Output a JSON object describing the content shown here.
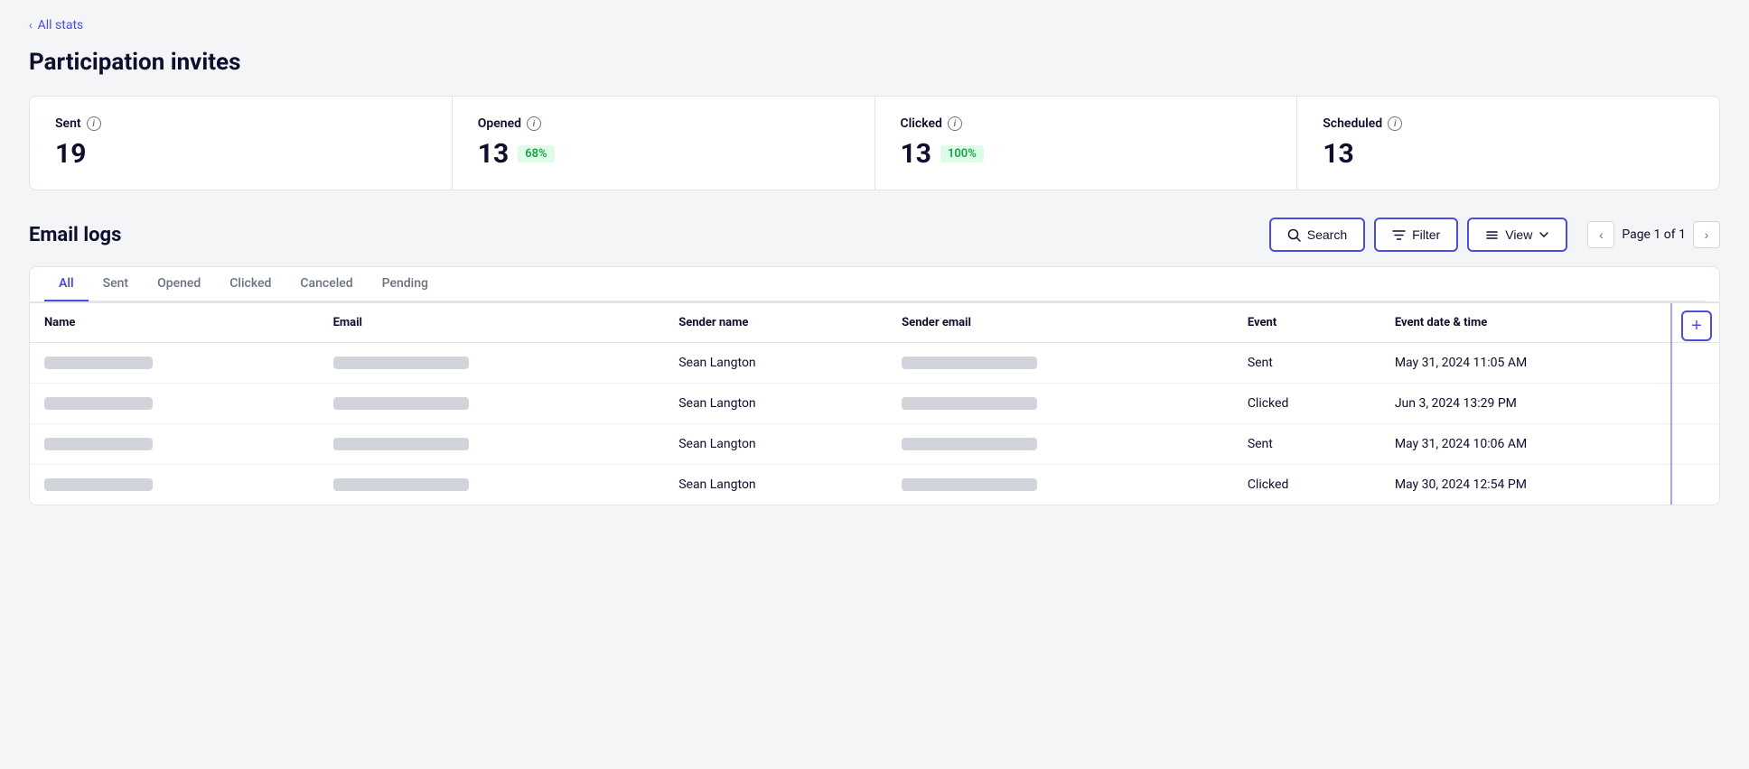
{
  "nav": {
    "back_label": "All stats"
  },
  "page": {
    "title": "Participation invites"
  },
  "stats": [
    {
      "id": "sent",
      "label": "Sent",
      "value": "19",
      "badge": null
    },
    {
      "id": "opened",
      "label": "Opened",
      "value": "13",
      "badge": "68%"
    },
    {
      "id": "clicked",
      "label": "Clicked",
      "value": "13",
      "badge": "100%"
    },
    {
      "id": "scheduled",
      "label": "Scheduled",
      "value": "13",
      "badge": null
    }
  ],
  "email_logs": {
    "section_title": "Email logs",
    "toolbar": {
      "search_label": "Search",
      "filter_label": "Filter",
      "view_label": "View"
    },
    "pagination": {
      "page_info": "Page 1 of 1"
    },
    "tabs": [
      {
        "id": "all",
        "label": "All",
        "active": true
      },
      {
        "id": "sent",
        "label": "Sent",
        "active": false
      },
      {
        "id": "opened",
        "label": "Opened",
        "active": false
      },
      {
        "id": "clicked",
        "label": "Clicked",
        "active": false
      },
      {
        "id": "canceled",
        "label": "Canceled",
        "active": false
      },
      {
        "id": "pending",
        "label": "Pending",
        "active": false
      }
    ],
    "table": {
      "columns": [
        "Name",
        "Email",
        "Sender name",
        "Sender email",
        "Event",
        "Event date & time"
      ],
      "rows": [
        {
          "name_placeholder": true,
          "email_placeholder": true,
          "sender_name": "Sean Langton",
          "sender_email_placeholder": true,
          "event": "Sent",
          "event_datetime": "May 31, 2024 11:05 AM"
        },
        {
          "name_placeholder": true,
          "email_placeholder": true,
          "sender_name": "Sean Langton",
          "sender_email_placeholder": true,
          "event": "Clicked",
          "event_datetime": "Jun 3, 2024 13:29 PM"
        },
        {
          "name_placeholder": true,
          "email_placeholder": true,
          "sender_name": "Sean Langton",
          "sender_email_placeholder": true,
          "event": "Sent",
          "event_datetime": "May 31, 2024 10:06 AM"
        },
        {
          "name_placeholder": true,
          "email_placeholder": true,
          "sender_name": "Sean Langton",
          "sender_email_placeholder": true,
          "event": "Clicked",
          "event_datetime": "May 30, 2024 12:54 PM"
        }
      ]
    }
  }
}
